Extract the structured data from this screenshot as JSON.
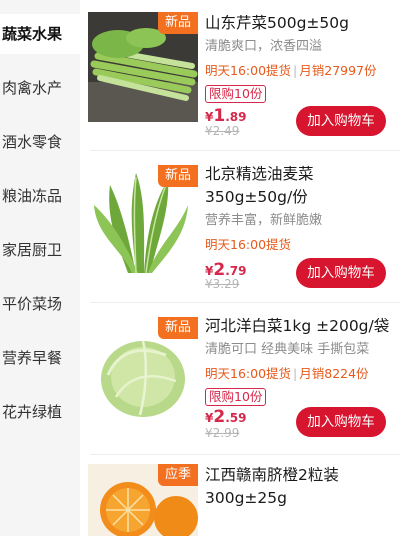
{
  "sidebar": {
    "items": [
      {
        "label": "蔬菜水果",
        "active": true
      },
      {
        "label": "肉禽水产",
        "active": false
      },
      {
        "label": "酒水零食",
        "active": false
      },
      {
        "label": "粮油冻品",
        "active": false
      },
      {
        "label": "家居厨卫",
        "active": false
      },
      {
        "label": "平价菜场",
        "active": false
      },
      {
        "label": "营养早餐",
        "active": false
      },
      {
        "label": "花卉绿植",
        "active": false
      }
    ]
  },
  "products": [
    {
      "tag": "新品",
      "name": "山东芹菜500g±50g",
      "desc": "清脆爽口，浓香四溢",
      "pickup": "明天16:00提货",
      "monthly_sales": "月销27997份",
      "limit": "限购10份",
      "price_yen": "¥",
      "price_int": "1",
      "price_dec": ".89",
      "old_price": "¥2.49",
      "cart_label": "加入购物车",
      "image": "celery"
    },
    {
      "tag": "新品",
      "name": "北京精选油麦菜350g±50g/份",
      "desc": "营养丰富，新鲜脆嫩",
      "pickup": "明天16:00提货",
      "monthly_sales": "",
      "limit": "",
      "price_yen": "¥",
      "price_int": "2",
      "price_dec": ".79",
      "old_price": "¥3.29",
      "cart_label": "加入购物车",
      "image": "lettuce"
    },
    {
      "tag": "新品",
      "name": "河北洋白菜1kg ±200g/袋",
      "desc": "清脆可口 经典美味 手撕包菜",
      "pickup": "明天16:00提货",
      "monthly_sales": "月销8224份",
      "limit": "限购10份",
      "price_yen": "¥",
      "price_int": "2",
      "price_dec": ".59",
      "old_price": "¥2.99",
      "cart_label": "加入购物车",
      "image": "cabbage"
    },
    {
      "tag": "应季",
      "name": "江西赣南脐橙2粒装300g±25g",
      "desc": "",
      "pickup": "",
      "monthly_sales": "",
      "limit": "",
      "price_yen": "",
      "price_int": "",
      "price_dec": "",
      "old_price": "",
      "cart_label": "",
      "image": "orange"
    }
  ],
  "colors": {
    "accent_red": "#d7152f",
    "tag_orange": "#f37021",
    "pickup_orange": "#e65a1c",
    "sidebar_bg": "#f5f5f5"
  }
}
